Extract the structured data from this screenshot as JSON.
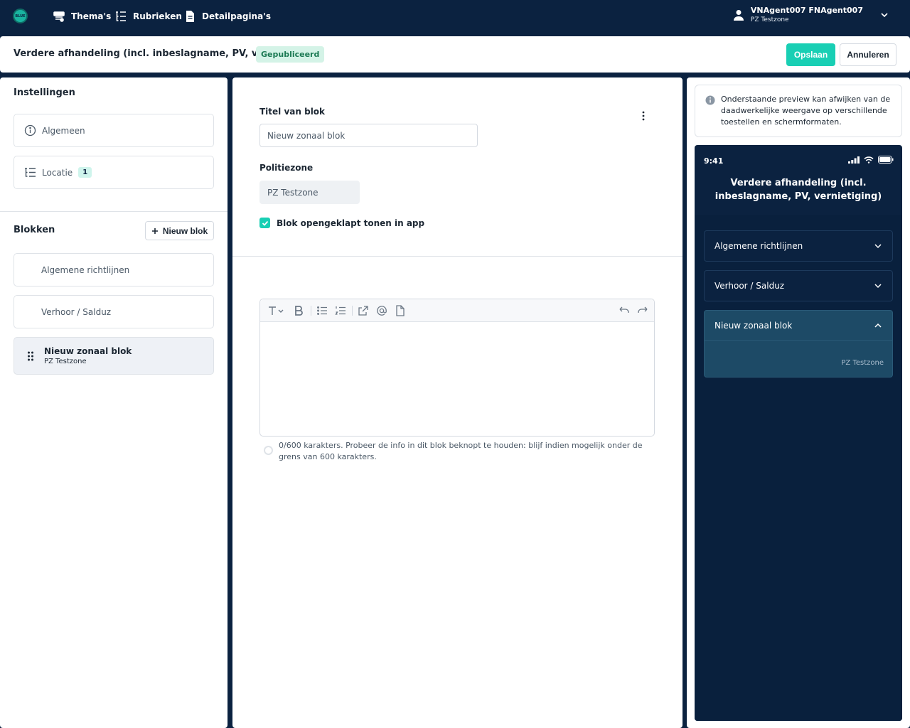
{
  "nav": {
    "logo": "BLUE",
    "items": [
      {
        "label": "Thema's",
        "icon": "themes-icon"
      },
      {
        "label": "Rubrieken",
        "icon": "rubrics-icon"
      },
      {
        "label": "Detailpagina's",
        "icon": "document-icon"
      }
    ],
    "user": {
      "name": "VNAgent007 FNAgent007",
      "zone": "PZ Testzone"
    }
  },
  "header": {
    "title": "Verdere afhandeling (incl. inbeslagname, PV, vernietiging)",
    "status": "Gepubliceerd",
    "save": "Opslaan",
    "cancel": "Annuleren"
  },
  "settings": {
    "title": "Instellingen",
    "items": [
      {
        "label": "Algemeen",
        "icon": "info-icon"
      },
      {
        "label": "Locatie",
        "icon": "location-list-icon",
        "count": "1"
      }
    ]
  },
  "blocks": {
    "title": "Blokken",
    "new_button": "Nieuw blok",
    "items": [
      {
        "label": "Algemene richtlijnen"
      },
      {
        "label": "Verhoor / Salduz"
      },
      {
        "label": "Nieuw zonaal blok",
        "sub": "PZ Testzone"
      }
    ]
  },
  "form": {
    "title_label": "Titel van blok",
    "title_value": "Nieuw zonaal blok",
    "zone_label": "Politiezone",
    "zone_value": "PZ Testzone",
    "checkbox_label": "Blok opengeklapt tonen in app",
    "checkbox_checked": true,
    "helper": "0/600 karakters. Probeer de info in dit blok beknopt te houden: blijf indien mogelijk onder de grens van 600 karakters."
  },
  "preview": {
    "notice": "Onderstaande preview kan afwijken van de daadwerkelijke weergave op verschillende toestellen en schermformaten.",
    "time": "9:41",
    "title": "Verdere afhandeling (incl. inbeslagname, PV, vernietiging)",
    "accordions": [
      {
        "label": "Algemene richtlijnen",
        "open": false
      },
      {
        "label": "Verhoor / Salduz",
        "open": false
      },
      {
        "label": "Nieuw zonaal blok",
        "open": true,
        "zone": "PZ Testzone"
      }
    ]
  }
}
